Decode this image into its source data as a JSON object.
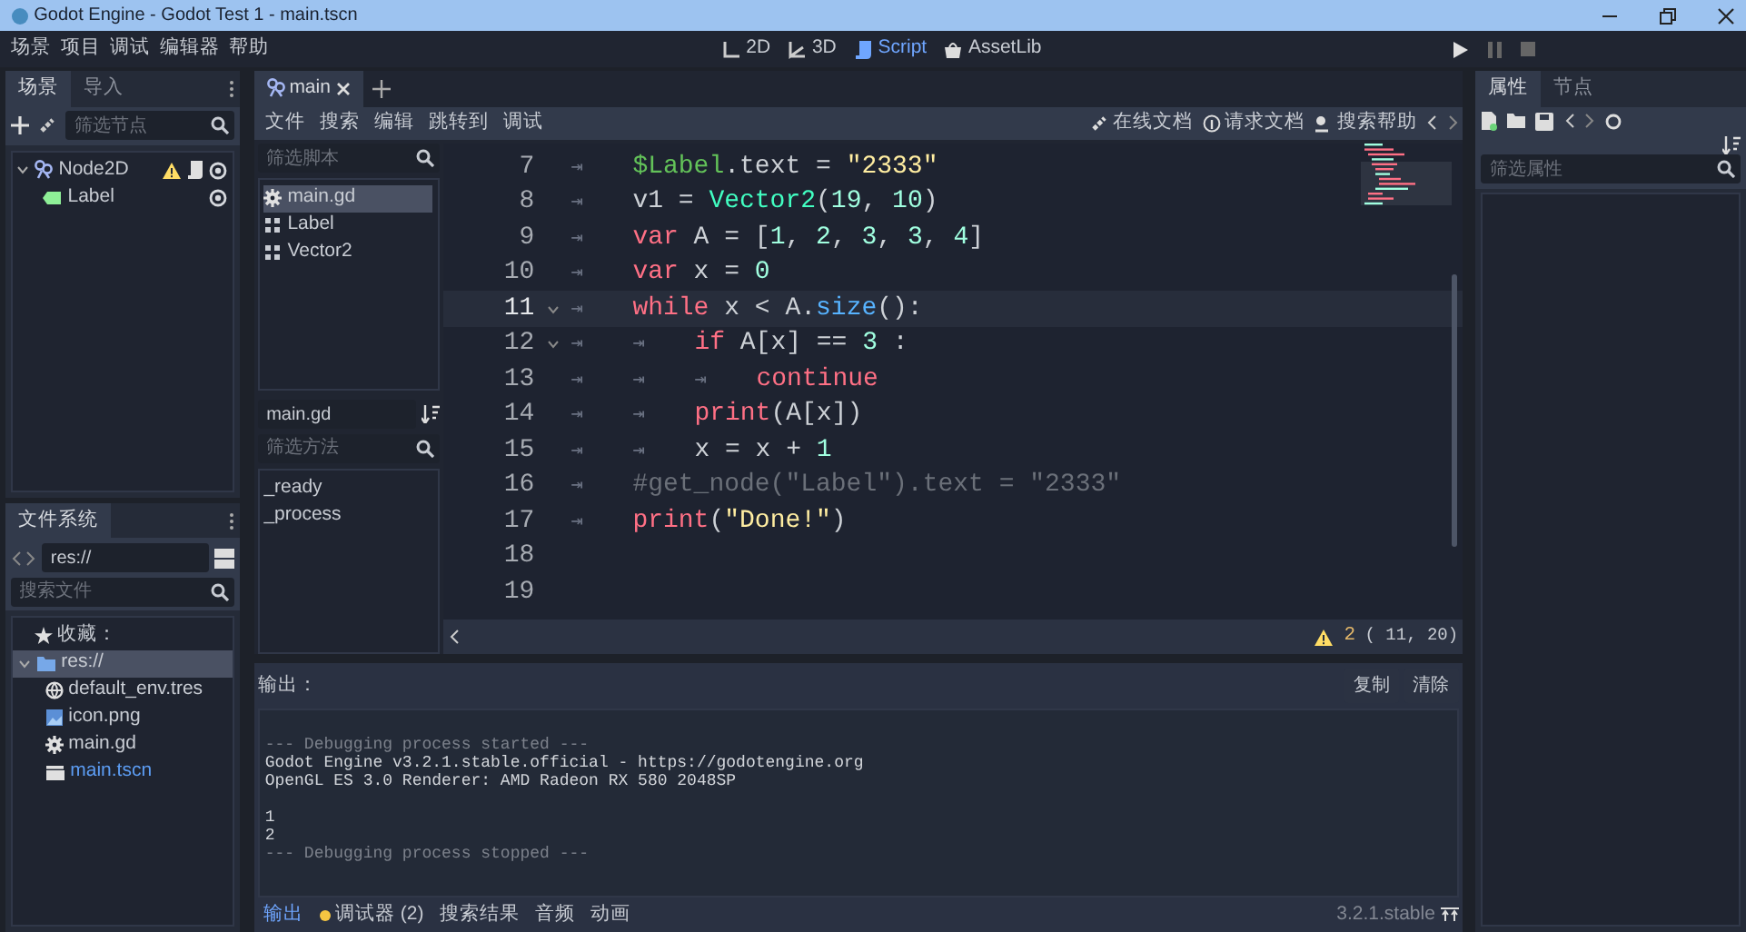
{
  "window": {
    "title": "Godot Engine - Godot Test 1 - main.tscn"
  },
  "menu": [
    "场景",
    "项目",
    "调试",
    "编辑器",
    "帮助"
  ],
  "workspaces": [
    {
      "label": "2D",
      "kind": "planar",
      "selected": false
    },
    {
      "label": "3D",
      "kind": "spatial",
      "selected": false
    },
    {
      "label": "Script",
      "kind": "script",
      "selected": true
    },
    {
      "label": "AssetLib",
      "kind": "assetlib",
      "selected": false
    }
  ],
  "scene_dock": {
    "tabs": [
      {
        "label": "场景",
        "selected": true
      },
      {
        "label": "导入",
        "selected": false
      }
    ],
    "filter": {
      "placeholder": "筛选节点"
    },
    "tree": [
      {
        "name": "Node2D",
        "kind": "node2d",
        "warning": true,
        "script": true,
        "visible": true,
        "expanded": true,
        "children": [
          {
            "name": "Label",
            "kind": "label",
            "warning": false,
            "script": false,
            "visible": true
          }
        ]
      }
    ]
  },
  "filesystem": {
    "tab": "文件系统",
    "path": "res://",
    "search": {
      "placeholder": "搜索文件"
    },
    "favorites": "收藏：",
    "tree": [
      {
        "name": "res://",
        "kind": "folder",
        "selected": true,
        "current": false,
        "expanded": true,
        "children": [
          {
            "name": "default_env.tres",
            "kind": "env",
            "selected": false,
            "current": false
          },
          {
            "name": "icon.png",
            "kind": "image",
            "selected": false,
            "current": false
          },
          {
            "name": "main.gd",
            "kind": "script",
            "selected": false,
            "current": false
          },
          {
            "name": "main.tscn",
            "kind": "scene",
            "selected": false,
            "current": true
          }
        ]
      }
    ]
  },
  "script_editor": {
    "tab": "main",
    "menu": [
      "文件",
      "搜索",
      "编辑",
      "跳转到",
      "调试"
    ],
    "help_links": [
      {
        "label": "在线文档",
        "kind": "link"
      },
      {
        "label": "请求文档",
        "kind": "info"
      },
      {
        "label": "搜索帮助",
        "kind": "search"
      }
    ],
    "script_filter": {
      "placeholder": "筛选脚本"
    },
    "scripts": [
      {
        "name": "main.gd",
        "kind": "script",
        "selected": true
      },
      {
        "name": "Label",
        "kind": "class",
        "selected": false
      },
      {
        "name": "Vector2",
        "kind": "class",
        "selected": false
      }
    ],
    "current_script": "main.gd",
    "method_filter": {
      "placeholder": "筛选方法"
    },
    "methods": [
      "_ready",
      "_process"
    ],
    "code": [
      {
        "number": "7",
        "foldable": false,
        "current": false,
        "tokens": [
          {
            "text": "⇥",
            "kind": "tab"
          },
          {
            "text": "$Label",
            "kind": "nodepath"
          },
          {
            "text": ".text = ",
            "kind": "plain"
          },
          {
            "text": "\"2333\"",
            "kind": "string"
          }
        ]
      },
      {
        "number": "8",
        "foldable": false,
        "current": false,
        "tokens": [
          {
            "text": "⇥",
            "kind": "tab"
          },
          {
            "text": "v1 = ",
            "kind": "plain"
          },
          {
            "text": "Vector2",
            "kind": "class"
          },
          {
            "text": "(",
            "kind": "plain"
          },
          {
            "text": "19",
            "kind": "number"
          },
          {
            "text": ", ",
            "kind": "plain"
          },
          {
            "text": "10",
            "kind": "number"
          },
          {
            "text": ")",
            "kind": "plain"
          }
        ]
      },
      {
        "number": "9",
        "foldable": false,
        "current": false,
        "tokens": [
          {
            "text": "⇥",
            "kind": "tab"
          },
          {
            "text": "var",
            "kind": "keyword"
          },
          {
            "text": " A = [",
            "kind": "plain"
          },
          {
            "text": "1",
            "kind": "number"
          },
          {
            "text": ", ",
            "kind": "plain"
          },
          {
            "text": "2",
            "kind": "number"
          },
          {
            "text": ", ",
            "kind": "plain"
          },
          {
            "text": "3",
            "kind": "number"
          },
          {
            "text": ", ",
            "kind": "plain"
          },
          {
            "text": "3",
            "kind": "number"
          },
          {
            "text": ", ",
            "kind": "plain"
          },
          {
            "text": "4",
            "kind": "number"
          },
          {
            "text": "]",
            "kind": "plain"
          }
        ]
      },
      {
        "number": "10",
        "foldable": false,
        "current": false,
        "tokens": [
          {
            "text": "⇥",
            "kind": "tab"
          },
          {
            "text": "var",
            "kind": "keyword"
          },
          {
            "text": " x = ",
            "kind": "plain"
          },
          {
            "text": "0",
            "kind": "number"
          }
        ]
      },
      {
        "number": "11",
        "foldable": true,
        "current": true,
        "tokens": [
          {
            "text": "⇥",
            "kind": "tab"
          },
          {
            "text": "while",
            "kind": "keyword"
          },
          {
            "text": " x < A.",
            "kind": "plain"
          },
          {
            "text": "size",
            "kind": "func"
          },
          {
            "text": "():",
            "kind": "plain"
          }
        ]
      },
      {
        "number": "12",
        "foldable": true,
        "current": false,
        "tokens": [
          {
            "text": "⇥",
            "kind": "tab"
          },
          {
            "text": "⇥",
            "kind": "tab"
          },
          {
            "text": "if",
            "kind": "keyword"
          },
          {
            "text": " A[x] == ",
            "kind": "plain"
          },
          {
            "text": "3",
            "kind": "number"
          },
          {
            "text": " :",
            "kind": "plain"
          }
        ]
      },
      {
        "number": "13",
        "foldable": false,
        "current": false,
        "tokens": [
          {
            "text": "⇥",
            "kind": "tab"
          },
          {
            "text": "⇥",
            "kind": "tab"
          },
          {
            "text": "⇥",
            "kind": "tab"
          },
          {
            "text": "continue",
            "kind": "keyword"
          }
        ]
      },
      {
        "number": "14",
        "foldable": false,
        "current": false,
        "tokens": [
          {
            "text": "⇥",
            "kind": "tab"
          },
          {
            "text": "⇥",
            "kind": "tab"
          },
          {
            "text": "print",
            "kind": "keyword"
          },
          {
            "text": "(A[x])",
            "kind": "plain"
          }
        ]
      },
      {
        "number": "15",
        "foldable": false,
        "current": false,
        "tokens": [
          {
            "text": "⇥",
            "kind": "tab"
          },
          {
            "text": "⇥",
            "kind": "tab"
          },
          {
            "text": "x = x + ",
            "kind": "plain"
          },
          {
            "text": "1",
            "kind": "number"
          }
        ]
      },
      {
        "number": "16",
        "foldable": false,
        "current": false,
        "tokens": [
          {
            "text": "⇥",
            "kind": "tab"
          },
          {
            "text": "#get_node(\"Label\").text = \"2333\"",
            "kind": "comment"
          }
        ]
      },
      {
        "number": "17",
        "foldable": false,
        "current": false,
        "tokens": [
          {
            "text": "⇥",
            "kind": "tab"
          },
          {
            "text": "print",
            "kind": "keyword"
          },
          {
            "text": "(",
            "kind": "plain"
          },
          {
            "text": "\"Done!\"",
            "kind": "string"
          },
          {
            "text": ")",
            "kind": "plain"
          }
        ]
      },
      {
        "number": "18",
        "foldable": false,
        "current": false
      },
      {
        "number": "19",
        "foldable": false,
        "current": false
      }
    ],
    "warnings": "2",
    "position": "( 11, 20)"
  },
  "output": {
    "title": "输出：",
    "buttons": [
      "复制",
      "清除"
    ],
    "lines": [
      {
        "kind": "blank"
      },
      {
        "text": "--- Debugging process started ---",
        "kind": "system"
      },
      {
        "text": "Godot Engine v3.2.1.stable.official - https://godotengine.org",
        "kind": "normal"
      },
      {
        "text": "OpenGL ES 3.0 Renderer: AMD Radeon RX 580 2048SP",
        "kind": "normal"
      },
      {
        "kind": "blank"
      },
      {
        "text": "1",
        "kind": "normal"
      },
      {
        "text": "2",
        "kind": "normal"
      },
      {
        "text": "--- Debugging process stopped ---",
        "kind": "system"
      }
    ]
  },
  "bottom_tabs": [
    {
      "label": "输出",
      "selected": true,
      "alert": false
    },
    {
      "label": "调试器 (2)",
      "selected": false,
      "alert": true
    },
    {
      "label": "搜索结果",
      "selected": false,
      "alert": false
    },
    {
      "label": "音频",
      "selected": false,
      "alert": false
    },
    {
      "label": "动画",
      "selected": false,
      "alert": false
    }
  ],
  "version": "3.2.1.stable",
  "inspector": {
    "tabs": [
      {
        "label": "属性",
        "selected": true
      },
      {
        "label": "节点",
        "selected": false
      }
    ],
    "filter": {
      "placeholder": "筛选属性"
    }
  }
}
